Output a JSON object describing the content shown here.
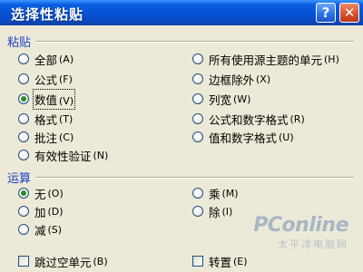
{
  "window": {
    "title": "选择性粘贴",
    "help_icon": "question-mark-icon",
    "close_icon": "close-x-icon"
  },
  "paste_group": {
    "label": "粘贴",
    "options_left": [
      {
        "label": "全部",
        "hotkey": "(A)",
        "selected": false
      },
      {
        "label": "公式",
        "hotkey": "(F)",
        "selected": false
      },
      {
        "label": "数值",
        "hotkey": "(V)",
        "selected": true
      },
      {
        "label": "格式",
        "hotkey": "(T)",
        "selected": false
      },
      {
        "label": "批注",
        "hotkey": "(C)",
        "selected": false
      },
      {
        "label": "有效性验证",
        "hotkey": "(N)",
        "selected": false
      }
    ],
    "options_right": [
      {
        "label": "所有使用源主题的单元",
        "hotkey": "(H)",
        "selected": false
      },
      {
        "label": "边框除外",
        "hotkey": "(X)",
        "selected": false
      },
      {
        "label": "列宽",
        "hotkey": "(W)",
        "selected": false
      },
      {
        "label": "公式和数字格式",
        "hotkey": "(R)",
        "selected": false
      },
      {
        "label": "值和数字格式",
        "hotkey": "(U)",
        "selected": false
      }
    ]
  },
  "operation_group": {
    "label": "运算",
    "options_left": [
      {
        "label": "无",
        "hotkey": "(O)",
        "selected": true
      },
      {
        "label": "加",
        "hotkey": "(D)",
        "selected": false
      },
      {
        "label": "减",
        "hotkey": "(S)",
        "selected": false
      }
    ],
    "options_right": [
      {
        "label": "乘",
        "hotkey": "(M)",
        "selected": false
      },
      {
        "label": "除",
        "hotkey": "(I)",
        "selected": false
      }
    ]
  },
  "checkboxes": [
    {
      "label": "跳过空单元",
      "hotkey": "(B)",
      "checked": false
    },
    {
      "label": "转置",
      "hotkey": "(E)",
      "checked": false
    }
  ],
  "watermark": {
    "main": "PConline",
    "sub": "太平洋电脑网"
  },
  "colors": {
    "titlebar": "#0651d3",
    "group_label": "#1a3fbf",
    "radio_dot": "#2a8c26",
    "close_button": "#d9512c",
    "dialog_bg": "#ece9d8"
  }
}
